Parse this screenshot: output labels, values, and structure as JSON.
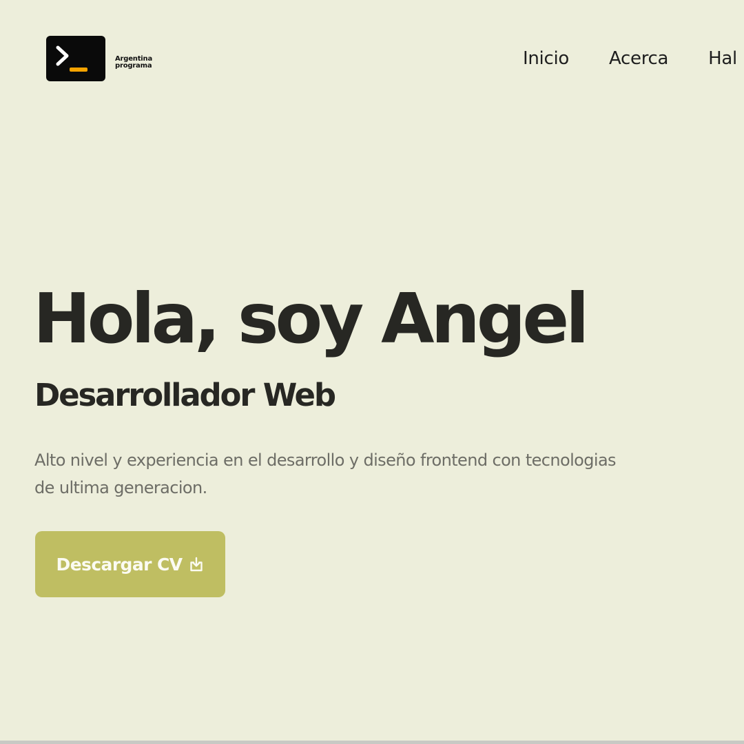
{
  "brand": {
    "line1": "Argentina",
    "line2": "programa",
    "logo_icon": "terminal-prompt-icon",
    "logo_bg": "#0a0a0a",
    "logo_accent": "#f5a300"
  },
  "nav": {
    "items": [
      {
        "label": "Inicio"
      },
      {
        "label": "Acerca"
      },
      {
        "label": "Hal"
      }
    ]
  },
  "hero": {
    "title": "Hola, soy Angel",
    "subtitle": "Desarrollador Web",
    "description": "Alto nivel y experiencia en el desarrollo y diseño frontend con tecnologias de ultima generacion.",
    "cta_label": "Descargar CV",
    "cta_icon": "download-icon"
  },
  "colors": {
    "background": "#edeedb",
    "accent": "#bfbe62",
    "text": "#272723",
    "muted_text": "#6d6d66"
  }
}
